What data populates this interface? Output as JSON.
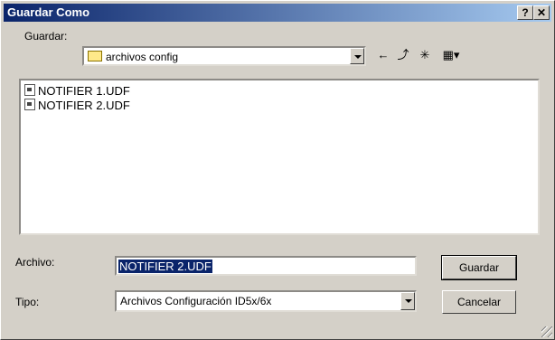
{
  "window": {
    "title": "Guardar Como",
    "help_button": "?",
    "close_button": "✕"
  },
  "location": {
    "label": "Guardar:",
    "value": "archivos config"
  },
  "toolbar": {
    "back": "←",
    "up_folder": "⤴",
    "new_folder": "✳",
    "views": "▦▾"
  },
  "files": [
    {
      "name": "NOTIFIER 1.UDF"
    },
    {
      "name": "NOTIFIER 2.UDF"
    }
  ],
  "filename": {
    "label": "Archivo:",
    "value": "NOTIFIER 2.UDF"
  },
  "filetype": {
    "label": "Tipo:",
    "value": "Archivos Configuración ID5x/6x"
  },
  "buttons": {
    "save": "Guardar",
    "cancel": "Cancelar"
  }
}
